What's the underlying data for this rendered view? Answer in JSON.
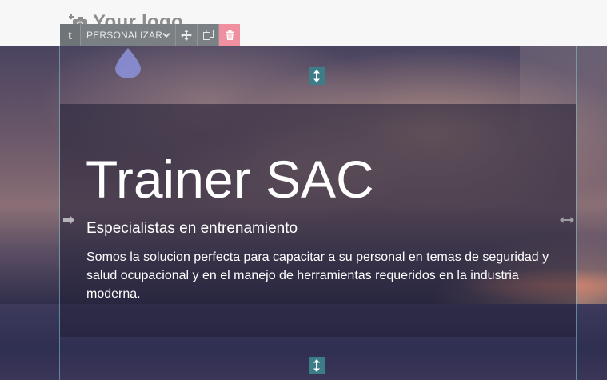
{
  "header": {
    "logo_text": "Your logo"
  },
  "toolbar": {
    "type_label": "t",
    "select_value": "PERSONALIZAR"
  },
  "hero": {
    "title": "Trainer SAC",
    "subtitle": "Especialistas en entrenamiento",
    "body": "Somos la solucion perfecta para capacitar a su personal en temas de seguridad y salud ocupacional y en el manejo de herramientas requeridos en la industria moderna."
  },
  "icons": {
    "logo": "camera-plus-icon",
    "dropdown": "chevron-down-icon",
    "move": "move-arrows-icon",
    "duplicate": "duplicate-icon",
    "delete": "trash-icon",
    "drop": "water-drop-icon",
    "resize_vertical": "resize-vertical-icon",
    "arrow_right": "arrow-right-icon",
    "resize_horizontal": "resize-horizontal-icon"
  },
  "colors": {
    "toolbar_bg": "#7b8084",
    "delete_bg": "#ef8fa0",
    "handle_bg": "#3d7d87",
    "drop_color": "#8a8fd6",
    "text_on_hero": "#ffffff"
  }
}
